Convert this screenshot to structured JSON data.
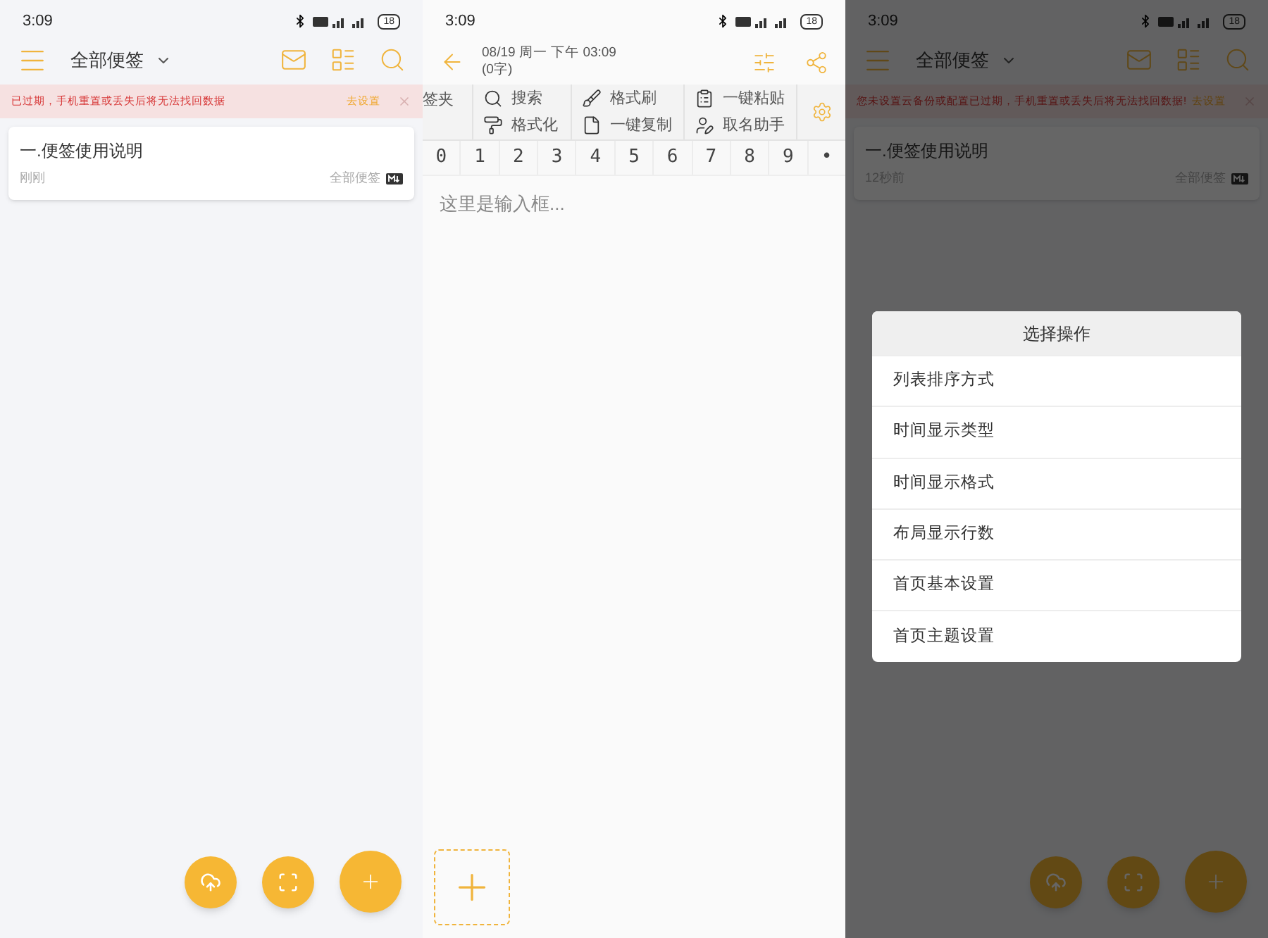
{
  "list_screen": {
    "status": {
      "time": "3:09",
      "battery": "18"
    },
    "title": "全部便签",
    "banner": {
      "text": "已过期，手机重置或丢失后将无法找回数据",
      "action": "去设置"
    },
    "notes": [
      {
        "title": "一.便签使用说明",
        "time": "刚刚",
        "folder": "全部便签"
      }
    ]
  },
  "editor_screen": {
    "status": {
      "time": "3:09",
      "battery": "18"
    },
    "date": "08/19 周一 下午 03:09",
    "count": "(0字)",
    "cut_tool": "签夹",
    "tools": [
      {
        "label": "搜索",
        "kind": "search"
      },
      {
        "label": "格式化",
        "kind": "roller"
      },
      {
        "label": "格式刷",
        "kind": "brush"
      },
      {
        "label": "一键复制",
        "kind": "copy"
      },
      {
        "label": "一键粘贴",
        "kind": "paste"
      },
      {
        "label": "取名助手",
        "kind": "person"
      }
    ],
    "keys": [
      "0",
      "1",
      "2",
      "3",
      "4",
      "5",
      "6",
      "7",
      "8",
      "9",
      "•"
    ],
    "placeholder": "这里是输入框..."
  },
  "menu_screen": {
    "status": {
      "time": "3:09",
      "battery": "18"
    },
    "title": "全部便签",
    "banner": {
      "text": "您未设置云备份或配置已过期，手机重置或丢失后将无法找回数据!",
      "action": "去设置"
    },
    "notes": [
      {
        "title": "一.便签使用说明",
        "time": "12秒前",
        "folder": "全部便签"
      }
    ],
    "dialog": {
      "title": "选择操作",
      "options": [
        "列表排序方式",
        "时间显示类型",
        "时间显示格式",
        "布局显示行数",
        "首页基本设置",
        "首页主题设置"
      ]
    }
  }
}
